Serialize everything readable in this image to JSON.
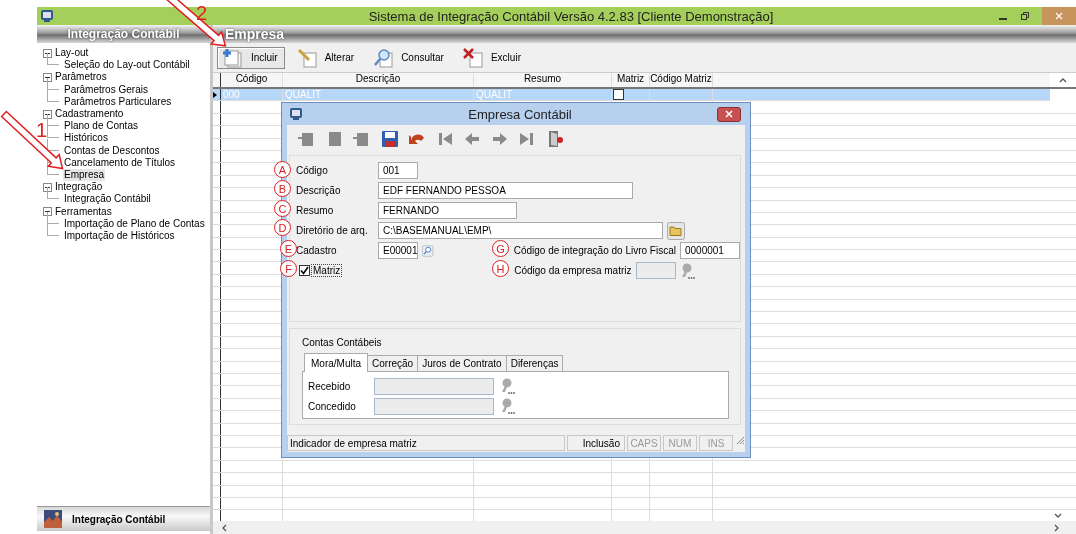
{
  "window": {
    "title": "Sistema de Integração Contábil Versão 4.2.83 [Cliente Demonstração]"
  },
  "sidebar": {
    "title": "Integração Contábil",
    "footer": "Integração Contábil",
    "tree": [
      {
        "label": "Lay-out",
        "expanded": true,
        "selected": false,
        "children": [
          {
            "label": "Seleção do Lay-out Contábil",
            "selected": false
          }
        ]
      },
      {
        "label": "Parâmetros",
        "expanded": true,
        "selected": false,
        "children": [
          {
            "label": "Parâmetros Gerais",
            "selected": false
          },
          {
            "label": "Parâmetros Particulares",
            "selected": false
          }
        ]
      },
      {
        "label": "Cadastramento",
        "expanded": true,
        "selected": false,
        "children": [
          {
            "label": "Plano de Contas",
            "selected": false
          },
          {
            "label": "Históricos",
            "selected": false
          },
          {
            "label": "Contas de Descontos",
            "selected": false
          },
          {
            "label": "Cancelamento de Títulos",
            "selected": false
          },
          {
            "label": "Empresa",
            "selected": true
          }
        ]
      },
      {
        "label": "Integração",
        "expanded": true,
        "selected": false,
        "children": [
          {
            "label": "Integração Contábil",
            "selected": false
          }
        ]
      },
      {
        "label": "Ferramentas",
        "expanded": true,
        "selected": false,
        "children": [
          {
            "label": "Importação de Plano de Contas",
            "selected": false
          },
          {
            "label": "Importação de Históricos",
            "selected": false
          }
        ]
      }
    ]
  },
  "main": {
    "title": "Empresa",
    "toolbar": [
      {
        "label": "Incluir",
        "kind": "add",
        "selected": true
      },
      {
        "label": "Alterar",
        "kind": "edit",
        "selected": false
      },
      {
        "label": "Consultar",
        "kind": "search",
        "selected": false
      },
      {
        "label": "Excluir",
        "kind": "delete",
        "selected": false
      }
    ],
    "table": {
      "columns": [
        "Código",
        "Descrição",
        "Resumo",
        "Matriz",
        "Código Matriz"
      ],
      "rows": [
        {
          "codigo": "000",
          "descricao": "QUALIT",
          "resumo": "QUALIT",
          "matriz": false,
          "selected": true
        }
      ]
    }
  },
  "dialog": {
    "title": "Empresa Contábil",
    "toolbar": [
      {
        "kind": "add",
        "disabled": true
      },
      {
        "kind": "edit",
        "disabled": true
      },
      {
        "kind": "delete",
        "disabled": true
      },
      {
        "kind": "save",
        "disabled": false
      },
      {
        "kind": "undo",
        "disabled": false
      },
      {
        "kind": "first",
        "disabled": true
      },
      {
        "kind": "prev",
        "disabled": true
      },
      {
        "kind": "next",
        "disabled": true
      },
      {
        "kind": "last",
        "disabled": true
      },
      {
        "kind": "exit",
        "disabled": false
      }
    ],
    "fields": [
      {
        "marker": "A",
        "label": "Código",
        "value": "001",
        "kind": "text"
      },
      {
        "marker": "B",
        "label": "Descrição",
        "value": "EDF FERNANDO PESSOA",
        "kind": "text"
      },
      {
        "marker": "C",
        "label": "Resumo",
        "value": "FERNANDO",
        "kind": "text"
      },
      {
        "marker": "D",
        "label": "Diretório de arq.",
        "value": "C:\\BASEMANUAL\\EMP\\",
        "kind": "folder"
      },
      {
        "marker": "E",
        "label": "Cadastro",
        "value": "E00001",
        "kind": "search"
      }
    ],
    "matriz": {
      "marker": "F",
      "label": "Matriz",
      "checked": true
    },
    "right_fields": [
      {
        "marker": "G",
        "label": "Código de integração do Livro Fiscal",
        "value": "0000001",
        "disabled": false
      },
      {
        "marker": "H",
        "label": "Código da empresa matriz",
        "disabled": true
      }
    ],
    "accounts": {
      "title": "Contas Contábeis",
      "tabs": [
        {
          "label": "Mora/Multa",
          "selected": true
        },
        {
          "label": "Correção",
          "selected": false
        },
        {
          "label": "Juros de Contrato",
          "selected": false
        },
        {
          "label": "Diferenças",
          "selected": false
        }
      ],
      "fields": [
        {
          "label": "Recebido",
          "disabled": true
        },
        {
          "label": "Concedido",
          "disabled": true
        }
      ]
    },
    "status": {
      "message": "Indicador de empresa matriz",
      "mode": "Inclusão",
      "keys": [
        {
          "label": "CAPS",
          "on": false
        },
        {
          "label": "NUM",
          "on": false
        },
        {
          "label": "INS",
          "on": false
        }
      ]
    }
  },
  "annotations": {
    "steps": [
      "1",
      "2"
    ]
  }
}
